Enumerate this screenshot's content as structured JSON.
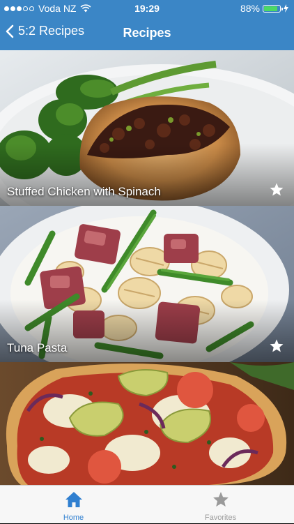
{
  "status_bar": {
    "carrier": "Voda NZ",
    "time": "19:29",
    "battery": "88%",
    "battery_level": 0.88
  },
  "nav": {
    "back_label": "5:2 Recipes",
    "title": "Recipes"
  },
  "recipes": [
    {
      "title": "Stuffed Chicken with Spinach"
    },
    {
      "title": "Tuna Pasta"
    },
    {
      "title": ""
    }
  ],
  "tabs": [
    {
      "label": "Home",
      "active": true
    },
    {
      "label": "Favorites",
      "active": false
    }
  ],
  "colors": {
    "accent": "#3b86c6",
    "tab_active": "#2f7fd0",
    "tab_inactive": "#9a9a9a"
  }
}
